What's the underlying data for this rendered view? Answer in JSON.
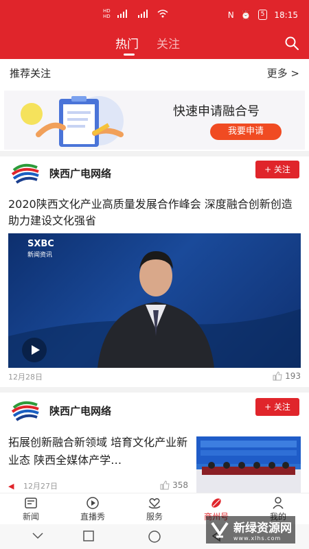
{
  "status_bar": {
    "time": "18:15",
    "battery": "5"
  },
  "header": {
    "tabs": [
      {
        "label": "热门",
        "active": true
      },
      {
        "label": "关注",
        "active": false
      }
    ]
  },
  "recommend": {
    "title": "推荐关注",
    "more": "更多 >"
  },
  "banner": {
    "title": "快速申请融合号",
    "button": "我要申请"
  },
  "posts": [
    {
      "account": "陕西广电网络",
      "follow": "+ 关注",
      "headline": "2020陕西文化产业高质量发展合作峰会 深度融合创新创造助力建设文化强省",
      "video_logo": "SXBC",
      "video_sub": "新闻资讯",
      "date": "12月28日",
      "likes": "193"
    },
    {
      "account": "陕西广电网络",
      "follow": "+ 关注",
      "headline": "拓展创新融合新领域 培育文化产业新业态 陕西全媒体产学…",
      "date": "12月27日",
      "likes": "358"
    }
  ],
  "bottom_nav": [
    {
      "label": "新闻",
      "icon": "news-icon",
      "active": false
    },
    {
      "label": "直播秀",
      "icon": "play-circle-icon",
      "active": false
    },
    {
      "label": "服务",
      "icon": "heart-hands-icon",
      "active": false
    },
    {
      "label": "商州号",
      "icon": "leaf-icon",
      "active": true
    },
    {
      "label": "我的",
      "icon": "person-icon",
      "active": false
    }
  ],
  "watermark": {
    "text": "新绿资源网",
    "url": "www.xlhs.com"
  },
  "colors": {
    "brand_red": "#e0252b",
    "apply_orange": "#f04b22"
  }
}
